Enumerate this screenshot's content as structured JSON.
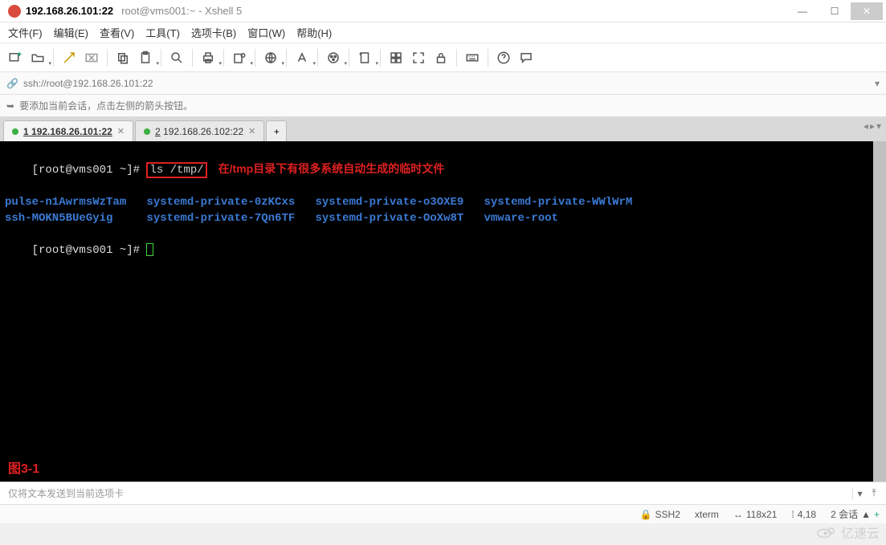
{
  "window": {
    "title": "192.168.26.101:22",
    "subtitle": "root@vms001:~ - Xshell 5"
  },
  "menu": {
    "file": "文件(F)",
    "edit": "编辑(E)",
    "view": "查看(V)",
    "tools": "工具(T)",
    "tabs": "选项卡(B)",
    "window": "窗口(W)",
    "help": "帮助(H)"
  },
  "address": {
    "url": "ssh://root@192.168.26.101:22"
  },
  "hint": {
    "text": "要添加当前会话，点击左侧的箭头按钮。"
  },
  "tabs": {
    "items": [
      {
        "index": "1",
        "label": "192.168.26.101:22"
      },
      {
        "index": "2",
        "label": "192.168.26.102:22"
      }
    ],
    "add": "+"
  },
  "terminal": {
    "prompt1": "[root@vms001 ~]# ",
    "cmd": "ls /tmp/",
    "annotation": "在/tmp目录下有很多系统自动生成的临时文件",
    "row1": "pulse-n1AwrmsWzTam   systemd-private-0zKCxs   systemd-private-o3OXE9   systemd-private-WWlWrM",
    "row2": "ssh-MOKN5BUeGyig     systemd-private-7Qn6TF   systemd-private-OoXw8T   vmware-root",
    "prompt2": "[root@vms001 ~]# ",
    "figlabel": "图3-1"
  },
  "sendbar": {
    "placeholder": "仅将文本发送到当前选项卡"
  },
  "status": {
    "proto": "SSH2",
    "term": "xterm",
    "size": "118x21",
    "pos": "4,18",
    "sessions": "2 会话"
  },
  "watermark": "亿速云"
}
